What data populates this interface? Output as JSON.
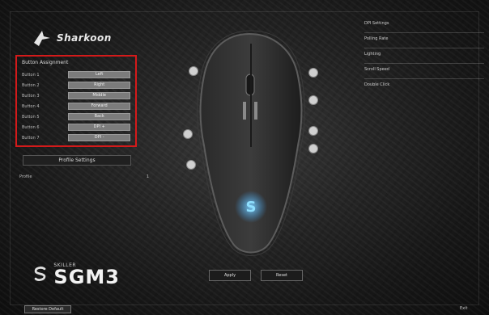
{
  "app": {
    "brand_name": "Sharkoon",
    "product_top": "SKILLER",
    "product_model": "SGM3"
  },
  "button_assignment": {
    "title": "Button Assignment",
    "rows": [
      {
        "label": "Button 1",
        "value": "Left"
      },
      {
        "label": "Button 2",
        "value": "Right"
      },
      {
        "label": "Button 3",
        "value": "Middle"
      },
      {
        "label": "Button 4",
        "value": "Forward"
      },
      {
        "label": "Button 5",
        "value": "Back"
      },
      {
        "label": "Button 6",
        "value": "DPI +"
      },
      {
        "label": "Button 7",
        "value": "DPI -"
      }
    ]
  },
  "profile": {
    "button_label": "Profile Settings",
    "row_label": "Profile",
    "row_value": "1"
  },
  "right_panel": {
    "rows": [
      {
        "label": "DPI Settings",
        "value": ""
      },
      {
        "label": "Polling Rate",
        "value": ""
      },
      {
        "label": "Lighting",
        "value": ""
      },
      {
        "label": "Scroll Speed",
        "value": ""
      },
      {
        "label": "Double Click",
        "value": ""
      }
    ]
  },
  "bottom": {
    "apply_label": "Apply",
    "reset_label": "Reset",
    "footer_left": "Restore Default",
    "footer_right": "Exit"
  },
  "colors": {
    "highlight": "#d41a1a",
    "logo_glow": "#3aa8ff"
  }
}
